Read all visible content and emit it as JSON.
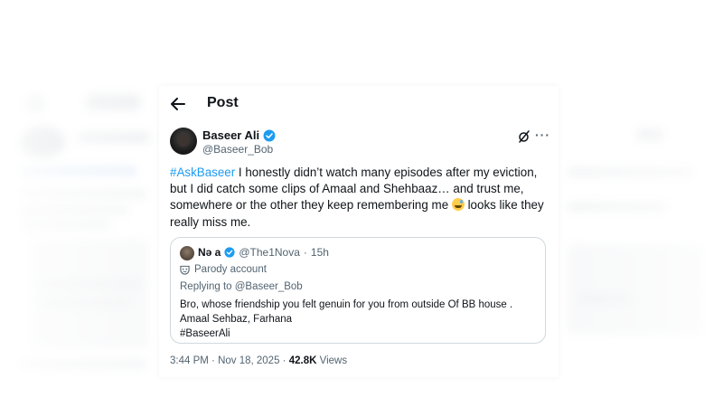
{
  "header": {
    "title": "Post"
  },
  "author": {
    "name": "Baseer Ali",
    "handle": "@Baseer_Bob"
  },
  "tweet": {
    "hashtag": "#AskBaseer",
    "text_before_emoji": " I honestly didn’t watch many episodes after my eviction, but I did catch some clips of Amaal and Shehbaaz… and trust me, somewhere or the other they keep remembering me ",
    "text_after_emoji": " looks like they really miss me."
  },
  "quote": {
    "name": "Nə a",
    "handle": "@The1Nova",
    "separator": "·",
    "time": "15h",
    "parody_label": "Parody account",
    "replying_to": "Replying to @Baseer_Bob",
    "body_lines": [
      "Bro, whose friendship you felt genuin for you from outside Of BB house .",
      "Amaal Sehbaz, Farhana",
      "#BaseerAli"
    ]
  },
  "meta": {
    "time": "3:44 PM",
    "separator1": " · ",
    "date": "Nov 18, 2025",
    "separator2": " · ",
    "views_count": "42.8K",
    "views_label": " Views"
  },
  "icons": {
    "back": "arrow-left-icon",
    "verified": "verified-badge-icon",
    "grok": "grok-icon",
    "more": "more-icon",
    "parody": "parody-mask-icon",
    "emoji": "grinning-sweat-emoji"
  },
  "colors": {
    "accent": "#1d9bf0",
    "text": "#0f1419",
    "secondary": "#536471",
    "border": "#cfd9de"
  }
}
